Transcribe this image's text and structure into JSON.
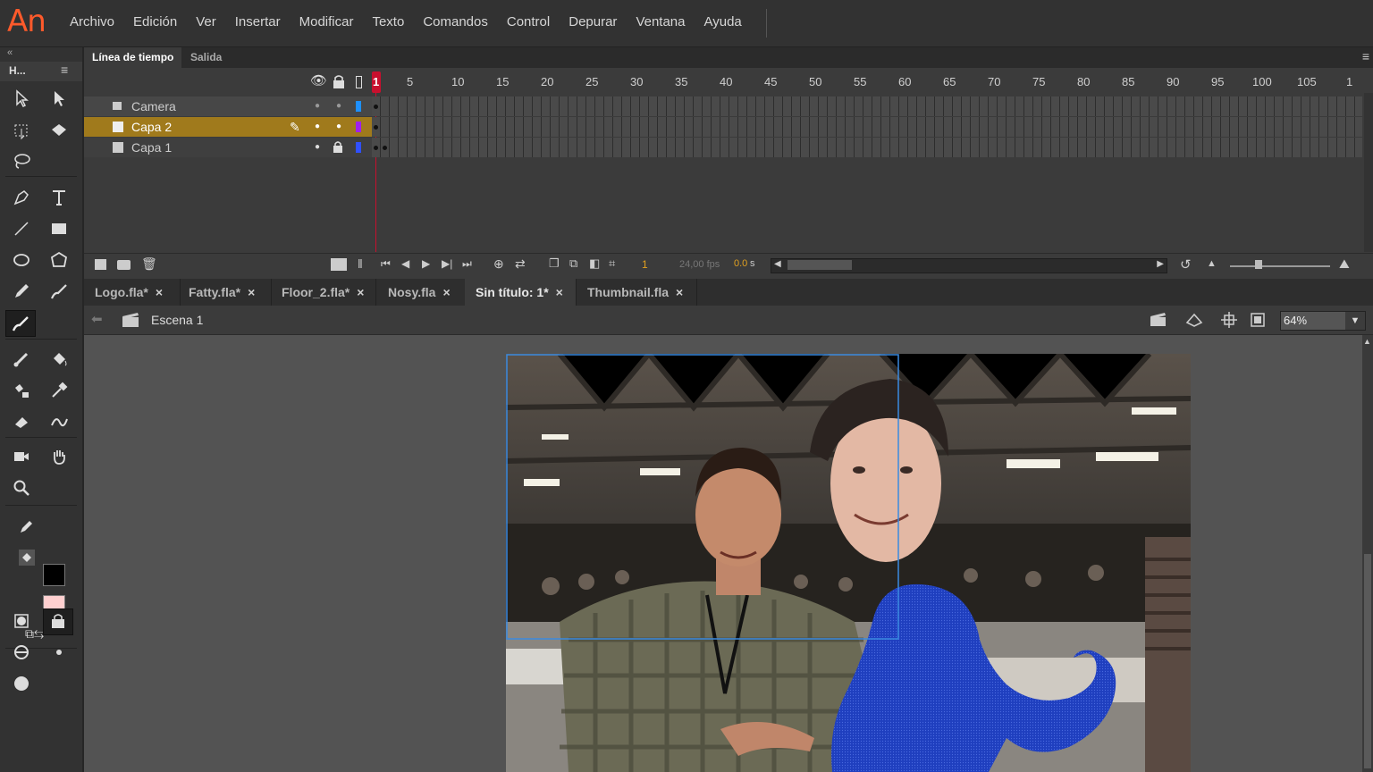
{
  "app": {
    "logo": "An"
  },
  "menu": [
    "Archivo",
    "Edición",
    "Ver",
    "Insertar",
    "Modificar",
    "Texto",
    "Comandos",
    "Control",
    "Depurar",
    "Ventana",
    "Ayuda"
  ],
  "toolbar": {
    "title": "H...",
    "stroke_color": "#000000",
    "fill_color": "#ffd0d0"
  },
  "timeline": {
    "tabs": [
      "Línea de tiempo",
      "Salida"
    ],
    "active_tab": "Línea de tiempo",
    "ruler": [
      "1",
      "5",
      "10",
      "15",
      "20",
      "25",
      "30",
      "35",
      "40",
      "45",
      "50",
      "55",
      "60",
      "65",
      "70",
      "75",
      "80",
      "85",
      "90",
      "95",
      "100",
      "105",
      "1"
    ],
    "layers": [
      {
        "name": "Camera",
        "color": "#1e90ff",
        "selected": false
      },
      {
        "name": "Capa 2",
        "color": "#a020f0",
        "selected": true
      },
      {
        "name": "Capa 1",
        "color": "#3050ff",
        "selected": false,
        "locked": true
      }
    ],
    "current_frame": "1",
    "fps": "24,00 fps",
    "time": "0.0",
    "time_unit": "s"
  },
  "documents": {
    "tabs": [
      {
        "label": "Logo.fla*"
      },
      {
        "label": "Fatty.fla*"
      },
      {
        "label": "Floor_2.fla*"
      },
      {
        "label": "Nosy.fla"
      },
      {
        "label": "Sin título: 1*",
        "active": true
      },
      {
        "label": "Thumbnail.fla"
      }
    ]
  },
  "scene": {
    "name": "Escena 1",
    "zoom": "64%"
  },
  "colors": {
    "accent_orange": "#ff5a2b",
    "selected_layer": "#a07a1c",
    "playhead": "#c8102e",
    "shape_blue": "#1f3fbf"
  }
}
